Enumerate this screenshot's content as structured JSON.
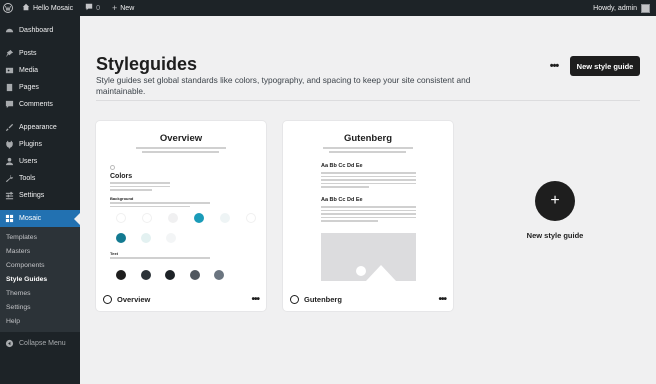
{
  "adminbar": {
    "site_name": "Hello Mosaic",
    "comments_count": "0",
    "new_label": "New",
    "greeting": "Howdy, admin"
  },
  "sidebar": {
    "items": [
      {
        "label": "Dashboard",
        "icon": "dashboard-icon"
      },
      {
        "label": "Posts",
        "icon": "pin-icon"
      },
      {
        "label": "Media",
        "icon": "media-icon"
      },
      {
        "label": "Pages",
        "icon": "page-icon"
      },
      {
        "label": "Comments",
        "icon": "comment-icon"
      },
      {
        "label": "Appearance",
        "icon": "brush-icon"
      },
      {
        "label": "Plugins",
        "icon": "plugin-icon"
      },
      {
        "label": "Users",
        "icon": "user-icon"
      },
      {
        "label": "Tools",
        "icon": "wrench-icon"
      },
      {
        "label": "Settings",
        "icon": "settings-icon"
      },
      {
        "label": "Mosaic",
        "icon": "mosaic-icon"
      }
    ],
    "submenu": [
      "Templates",
      "Masters",
      "Components",
      "Style Guides",
      "Themes",
      "Settings",
      "Help"
    ],
    "collapse_label": "Collapse Menu"
  },
  "main": {
    "title": "Styleguides",
    "description": "Style guides set global standards like colors, typography, and spacing to keep your site consistent and maintainable.",
    "more_label": "•••",
    "new_button": "New style guide",
    "new_card_label": "New style guide"
  },
  "cards": [
    {
      "name": "Overview",
      "preview_title": "Overview",
      "section": "Colors",
      "sub_background": "Background",
      "sub_text": "Text",
      "menu": "•••"
    },
    {
      "name": "Gutenberg",
      "preview_title": "Gutenberg",
      "heading1": "Aa Bb Cc Dd Ee",
      "heading2": "Aa Bb Cc Dd Ee",
      "menu": "•••"
    }
  ],
  "colors": {
    "admin_bg": "#1d2327",
    "active": "#2271b1",
    "teal": "#1a9bb8",
    "dark_swatch": "#1e1e1e",
    "grey_swatch": "#6b7580"
  }
}
